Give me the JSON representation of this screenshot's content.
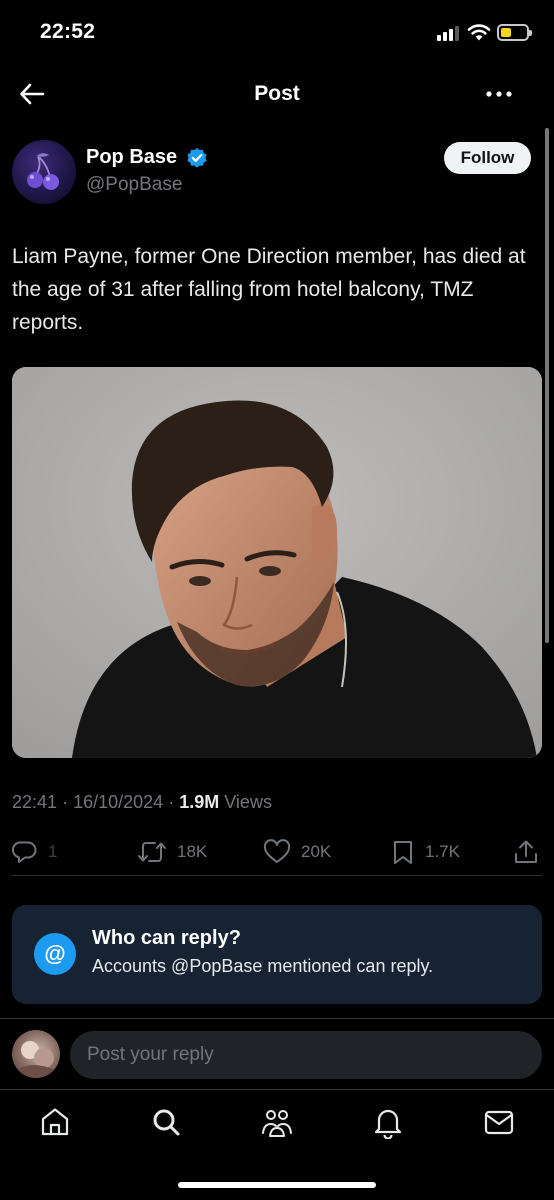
{
  "status_bar": {
    "time": "22:52",
    "signal_bars_active": 3,
    "signal_bars_total": 4,
    "battery_level": 0.25,
    "battery_color": "#ffd60a"
  },
  "header": {
    "title": "Post",
    "back_icon": "arrow-left-icon",
    "more_icon": "more-horizontal-icon"
  },
  "author": {
    "name": "Pop Base",
    "handle": "@PopBase",
    "verified": true,
    "verified_color": "#1d9bf0",
    "follow_label": "Follow"
  },
  "post": {
    "text": "Liam Payne, former One Direction member, has died at the age of 31 after falling from hotel balcony, TMZ reports.",
    "time": "22:41",
    "date": "16/10/2024",
    "views_count": "1.9M",
    "views_label": "Views",
    "separator": "·"
  },
  "actions": {
    "replies": "1",
    "reposts": "18K",
    "likes": "20K",
    "bookmarks": "1.7K"
  },
  "reply_restriction": {
    "icon_text": "@",
    "title": "Who can reply?",
    "description": "Accounts @PopBase mentioned can reply."
  },
  "composer": {
    "placeholder": "Post your reply"
  },
  "tabbar": {
    "items": [
      "home-icon",
      "search-icon",
      "communities-icon",
      "notifications-icon",
      "messages-icon"
    ]
  },
  "colors": {
    "background": "#000000",
    "accent": "#1d9bf0",
    "muted_text": "#71767b"
  }
}
